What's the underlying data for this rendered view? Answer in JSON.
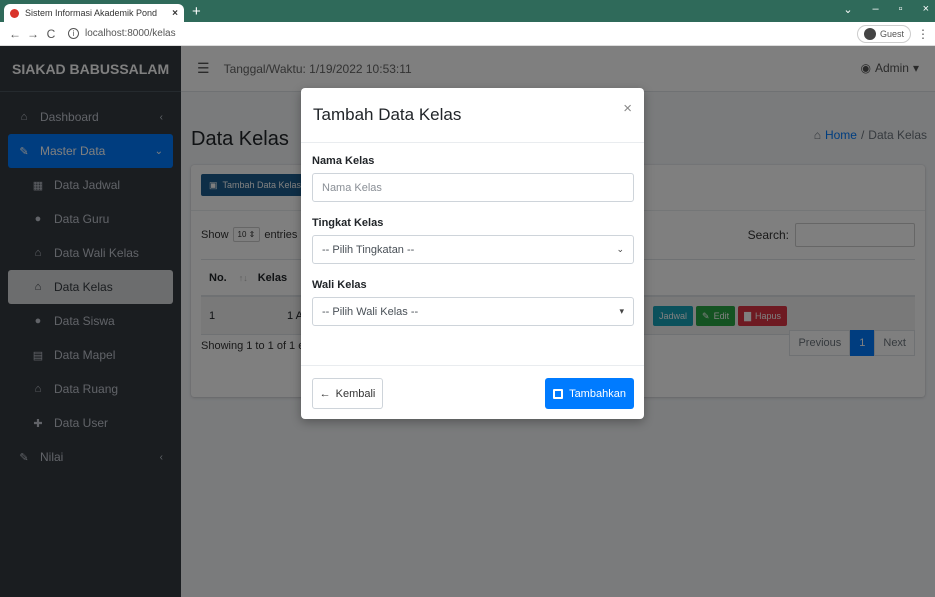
{
  "browser": {
    "tab_title": "Sistem Informasi Akademik Pond",
    "tab_close": "×",
    "new_tab": "+",
    "url": "localhost:8000/kelas",
    "guest_label": "Guest",
    "window_controls": [
      "⌄",
      "–",
      "▫",
      "×"
    ]
  },
  "sidebar": {
    "brand": "SIAKAD BABUSSALAM",
    "items": [
      {
        "label": "Dashboard",
        "icon": "home-icon"
      },
      {
        "label": "Master Data",
        "icon": "edit-icon"
      },
      {
        "label": "Data Jadwal",
        "icon": "calendar-icon"
      },
      {
        "label": "Data Guru",
        "icon": "users-icon"
      },
      {
        "label": "Data Wali Kelas",
        "icon": "home-icon"
      },
      {
        "label": "Data Kelas",
        "icon": "home-icon"
      },
      {
        "label": "Data Siswa",
        "icon": "users-icon"
      },
      {
        "label": "Data Mapel",
        "icon": "book-icon"
      },
      {
        "label": "Data Ruang",
        "icon": "home-icon"
      },
      {
        "label": "Data User",
        "icon": "user-plus-icon"
      },
      {
        "label": "Nilai",
        "icon": "file-edit-icon"
      }
    ]
  },
  "navbar": {
    "datetime": "Tanggal/Waktu: 1/19/2022 10:53:11",
    "admin": "Admin"
  },
  "page": {
    "title": "Data Kelas",
    "breadcrumb_home": "Home",
    "breadcrumb_sep": "/",
    "breadcrumb_current": "Data Kelas"
  },
  "table": {
    "add_button": "Tambah Data Kelas",
    "show": "Show",
    "entries_value": "10",
    "entries": "entries",
    "search_label": "Search:",
    "headers": [
      "No.",
      "Kelas"
    ],
    "rows": [
      [
        "1",
        "1 A"
      ]
    ],
    "action_info": "Jadwal",
    "action_edit": "Edit",
    "action_delete": "Hapus",
    "showing": "Showing 1 to 1 of 1 entries",
    "prev": "Previous",
    "page": "1",
    "next": "Next"
  },
  "modal": {
    "title": "Tambah Data Kelas",
    "close": "×",
    "nama_label": "Nama Kelas",
    "nama_placeholder": "Nama Kelas",
    "tingkat_label": "Tingkat Kelas",
    "tingkat_value": "-- Pilih Tingkatan --",
    "wali_label": "Wali Kelas",
    "wali_value": "-- Pilih Wali Kelas --",
    "back_button": "Kembali",
    "save_button": "Tambahkan"
  },
  "colors": {
    "sidebar_bg": "#343a40",
    "primary": "#007bff",
    "tab_bar": "#2f6a5a"
  }
}
